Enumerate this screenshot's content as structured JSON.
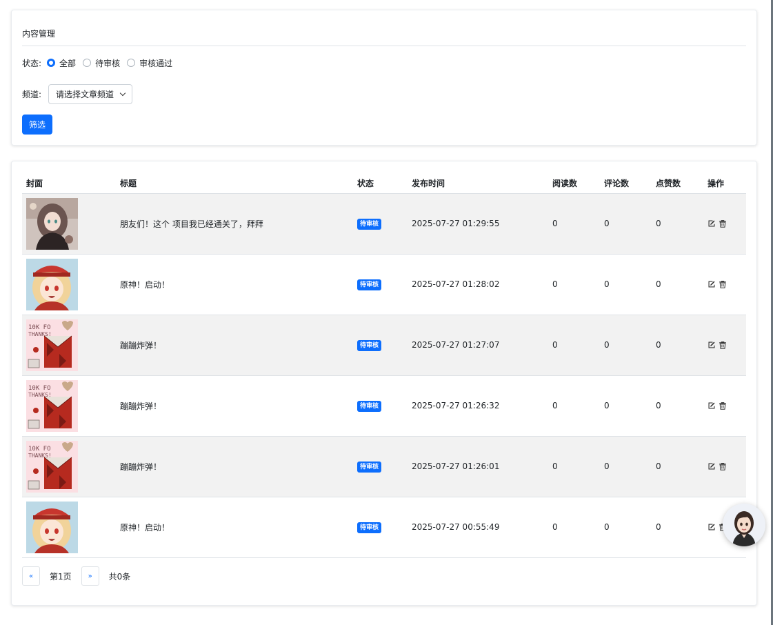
{
  "filter": {
    "title": "内容管理",
    "status_label": "状态:",
    "status_options": [
      "全部",
      "待审核",
      "审核通过"
    ],
    "status_selected": "全部",
    "channel_label": "频道:",
    "channel_placeholder": "请选择文章频道",
    "submit_label": "筛选"
  },
  "table": {
    "columns": [
      "封面",
      "标题",
      "状态",
      "发布时间",
      "阅读数",
      "评论数",
      "点赞数",
      "操作"
    ],
    "rows": [
      {
        "cover": "anime-girl-dark-hair",
        "title": "朋友们！这个 项目我已经通关了，拜拜",
        "status": "待审核",
        "time": "2025-07-27 01:29:55",
        "reads": "0",
        "comments": "0",
        "likes": "0"
      },
      {
        "cover": "anime-girl-red-hat",
        "title": "原神！启动！",
        "status": "待审核",
        "time": "2025-07-27 01:28:02",
        "reads": "0",
        "comments": "0",
        "likes": "0"
      },
      {
        "cover": "pink-thanks-card",
        "title": "蹦蹦炸弹！",
        "status": "待审核",
        "time": "2025-07-27 01:27:07",
        "reads": "0",
        "comments": "0",
        "likes": "0"
      },
      {
        "cover": "pink-thanks-card",
        "title": "蹦蹦炸弹！",
        "status": "待审核",
        "time": "2025-07-27 01:26:32",
        "reads": "0",
        "comments": "0",
        "likes": "0"
      },
      {
        "cover": "pink-thanks-card",
        "title": "蹦蹦炸弹！",
        "status": "待审核",
        "time": "2025-07-27 01:26:01",
        "reads": "0",
        "comments": "0",
        "likes": "0"
      },
      {
        "cover": "anime-girl-red-hat",
        "title": "原神！启动！",
        "status": "待审核",
        "time": "2025-07-27 00:55:49",
        "reads": "0",
        "comments": "0",
        "likes": "0"
      }
    ],
    "cover_text": "10K FO THANKS!"
  },
  "pager": {
    "prev": "«",
    "current": "第1页",
    "next": "»",
    "total": "共0条"
  },
  "icons": {
    "edit": "edit-icon",
    "delete": "trash-icon",
    "dropdown": "chevron-down-icon"
  },
  "colors": {
    "primary": "#0d6efd",
    "row_stripe": "#f2f2f2"
  }
}
